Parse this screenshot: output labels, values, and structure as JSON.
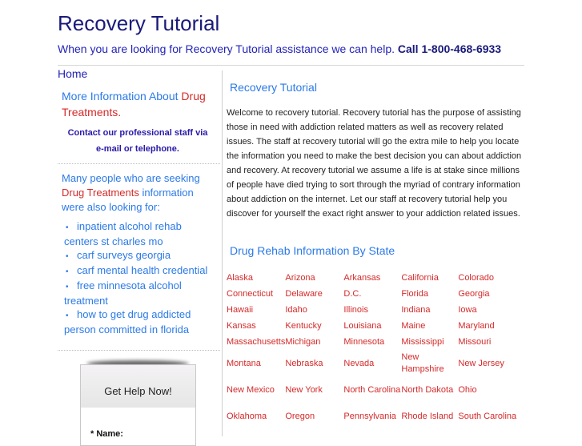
{
  "header": {
    "title": "Recovery Tutorial",
    "tagline": "When you are looking for Recovery Tutorial assistance we can help.",
    "phone": "Call 1-800-468-6933"
  },
  "sidebar": {
    "home": "Home",
    "more_info_prefix": "More Information About ",
    "more_info_link": "Drug Treatments",
    "more_info_suffix": ".",
    "contact_line1": "Contact our professional staff via",
    "contact_line2": "e-mail or telephone.",
    "seeking_prefix": "Many people who are seeking",
    "seeking_link": "Drug Treatments",
    "seeking_suffix": " information were also looking for:",
    "bullet_icon": "•",
    "also_looking": [
      "inpatient alcohol rehab centers st charles mo",
      "carf surveys georgia",
      "carf mental health credential",
      "free minnesota alcohol treatment",
      "how to get drug addicted person committed in florida"
    ],
    "help_box": {
      "title": "Get Help Now!",
      "name_label": "* Name:"
    }
  },
  "main": {
    "heading": "Recovery Tutorial",
    "intro": "Welcome to recovery tutorial. Recovery tutorial has the purpose of assisting those in need with addiction related matters as well as recovery related issues. The staff at recovery tutorial will go the extra mile to help you locate the information you need to make the best decision you can about addiction and recovery. At recovery tutorial we assume a life is at stake since millions of people have died trying to sort through the myriad of contrary information about addiction on the internet. Let our staff at recovery tutorial help you discover for yourself the exact right answer to your addiction related issues.",
    "states_heading": "Drug Rehab Information By State",
    "states": [
      [
        "Alaska",
        "Arizona",
        "Arkansas",
        "California",
        "Colorado"
      ],
      [
        "Connecticut",
        "Delaware",
        "D.C.",
        "Florida",
        "Georgia"
      ],
      [
        "Hawaii",
        "Idaho",
        "Illinois",
        "Indiana",
        "Iowa"
      ],
      [
        "Kansas",
        "Kentucky",
        "Louisiana",
        "Maine",
        "Maryland"
      ],
      [
        "Massachusetts",
        "Michigan",
        "Minnesota",
        "Mississippi",
        "Missouri"
      ],
      [
        "Montana",
        "Nebraska",
        "Nevada",
        "New Hampshire",
        "New Jersey"
      ],
      [
        "New Mexico",
        "New York",
        "North Carolina",
        "North Dakota",
        "Ohio"
      ],
      [
        "Oklahoma",
        "Oregon",
        "Pennsylvania",
        "Rhode Island",
        "South Carolina"
      ]
    ]
  },
  "colors": {
    "title": "#1a1a7a",
    "link_blue": "#2b7ae8",
    "link_red": "#d42a2a",
    "contact_purple": "#2a1aa8"
  }
}
